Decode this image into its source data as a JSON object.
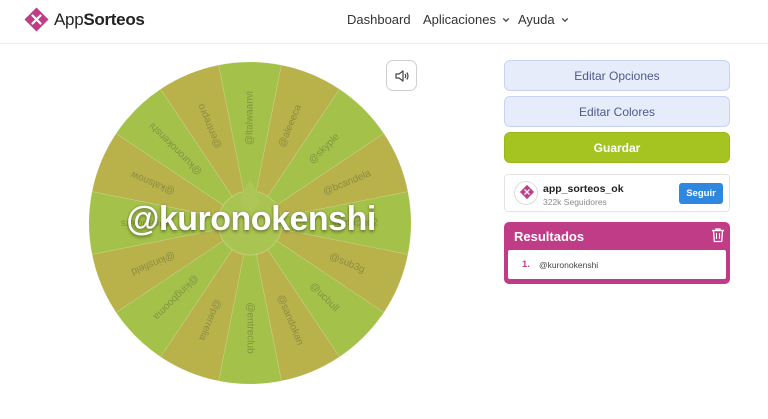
{
  "header": {
    "logo": {
      "text_a": "App",
      "text_b": "Sorteos",
      "color": "#c03c86"
    },
    "nav": [
      {
        "label": "Dashboard",
        "has_caret": false
      },
      {
        "label": "Aplicaciones",
        "has_caret": true
      },
      {
        "label": "Ayuda",
        "has_caret": true
      }
    ]
  },
  "wheel": {
    "colors": [
      "#9dbd3a",
      "#b3ac3c"
    ],
    "winner": "@kuronokenshi",
    "segments": [
      "@ltalwaanvi",
      "@aleeeca",
      "@skyple",
      "@bcandela",
      "@mapao2",
      "@sub3g",
      "@ucbull",
      "@sandokan",
      "@entreclub",
      "@perrelia",
      "@kingbooma",
      "@kinsfield",
      "@gaudlers",
      "@kalsnow",
      "@kuronokenshi",
      "@entrepro"
    ]
  },
  "sound_button": {
    "icon": "speaker-icon"
  },
  "actions": {
    "edit_options": "Editar Opciones",
    "edit_colors": "Editar Colores",
    "save": "Guardar"
  },
  "profile": {
    "name": "app_sorteos_ok",
    "followers": "322k Seguidores",
    "follow_label": "Seguir"
  },
  "results": {
    "title": "Resultados",
    "items": [
      {
        "num": "1.",
        "name": "@kuronokenshi"
      }
    ]
  }
}
